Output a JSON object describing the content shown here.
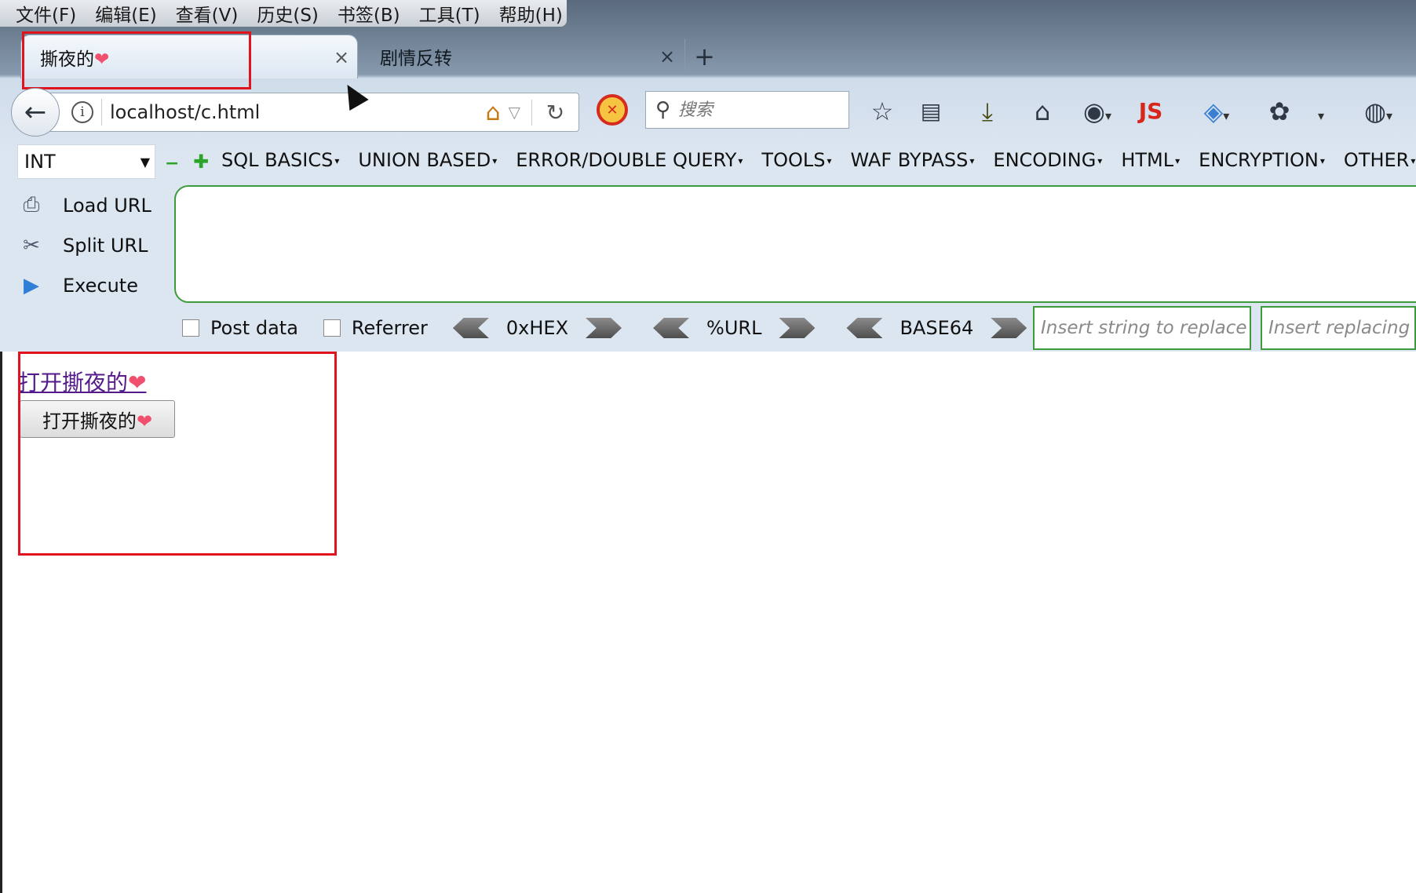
{
  "menubar": {
    "items": [
      "文件(F)",
      "编辑(E)",
      "查看(V)",
      "历史(S)",
      "书签(B)",
      "工具(T)",
      "帮助(H)"
    ]
  },
  "tabs": [
    {
      "title": "撕夜的",
      "active": true,
      "close": "×"
    },
    {
      "title": "剧情反转",
      "active": false,
      "close": "×"
    }
  ],
  "new_tab_label": "+",
  "heart_symbol": "❤",
  "navbar": {
    "url": "localhost/c.html",
    "search_placeholder": "搜索",
    "addon_label": "JS"
  },
  "hackbar": {
    "type_select": "INT",
    "menus": [
      "SQL BASICS",
      "UNION BASED",
      "ERROR/DOUBLE QUERY",
      "TOOLS",
      "WAF BYPASS",
      "ENCODING",
      "HTML",
      "ENCRYPTION",
      "OTHER"
    ],
    "actions": [
      "Load URL",
      "Split URL",
      "Execute"
    ],
    "checkboxes": [
      "Post data",
      "Referrer"
    ],
    "encoders": [
      "0xHEX",
      "%URL",
      "BASE64"
    ],
    "replace_placeholder": "Insert string to replace",
    "replacing_placeholder": "Insert replacing"
  },
  "content": {
    "link_text": "打开撕夜的",
    "button_text": "打开撕夜的"
  },
  "colors": {
    "highlight_box": "#e0141e",
    "heart": "#f0506e",
    "visited_link": "#551a8b",
    "hackbar_green": "#3d9b3d"
  }
}
